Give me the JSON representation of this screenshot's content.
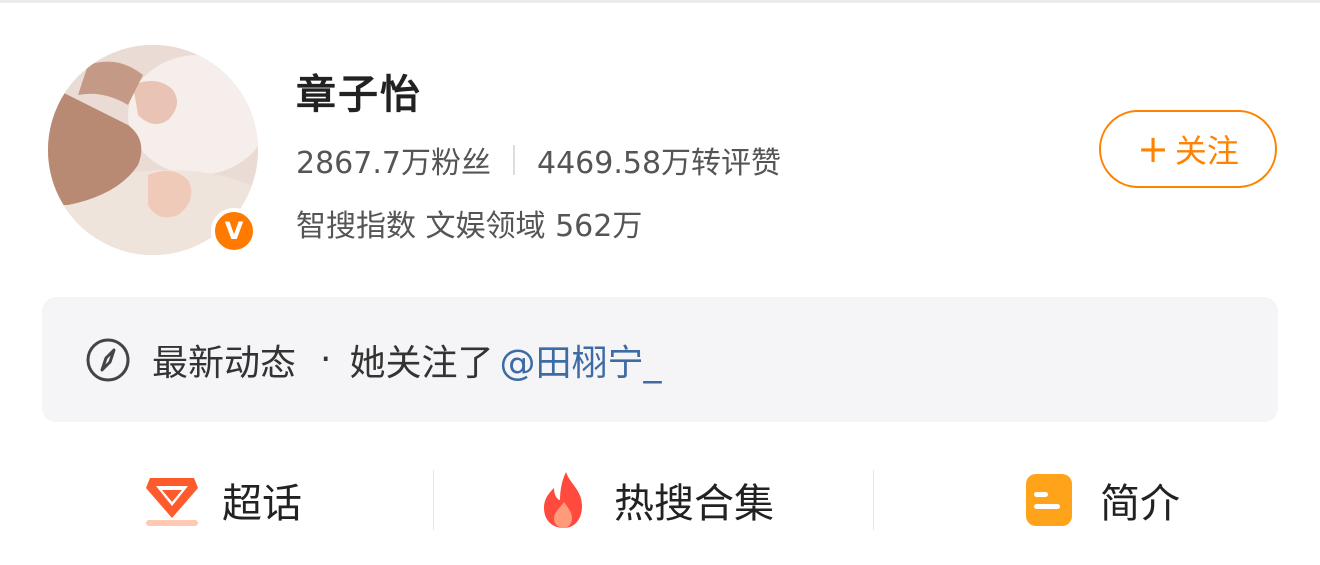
{
  "profile": {
    "name": "章子怡",
    "followers": "2867.7万粉丝",
    "engagement": "4469.58万转评赞",
    "search_index": "智搜指数 文娱领域 562万",
    "verified_badge": "V",
    "follow_button": "关注",
    "follow_plus": "+"
  },
  "activity": {
    "label": "最新动态",
    "separator": "·",
    "action": "她关注了",
    "mention": "@田栩宁_"
  },
  "bottom_nav": {
    "items": [
      {
        "label": "超话",
        "icon": "supertopic-icon"
      },
      {
        "label": "热搜合集",
        "icon": "flame-icon"
      },
      {
        "label": "简介",
        "icon": "profile-doc-icon"
      }
    ]
  },
  "colors": {
    "accent": "#ff8200",
    "mention": "#3d6ba3",
    "badge": "#ff7a00",
    "card_bg": "#f5f5f7"
  }
}
